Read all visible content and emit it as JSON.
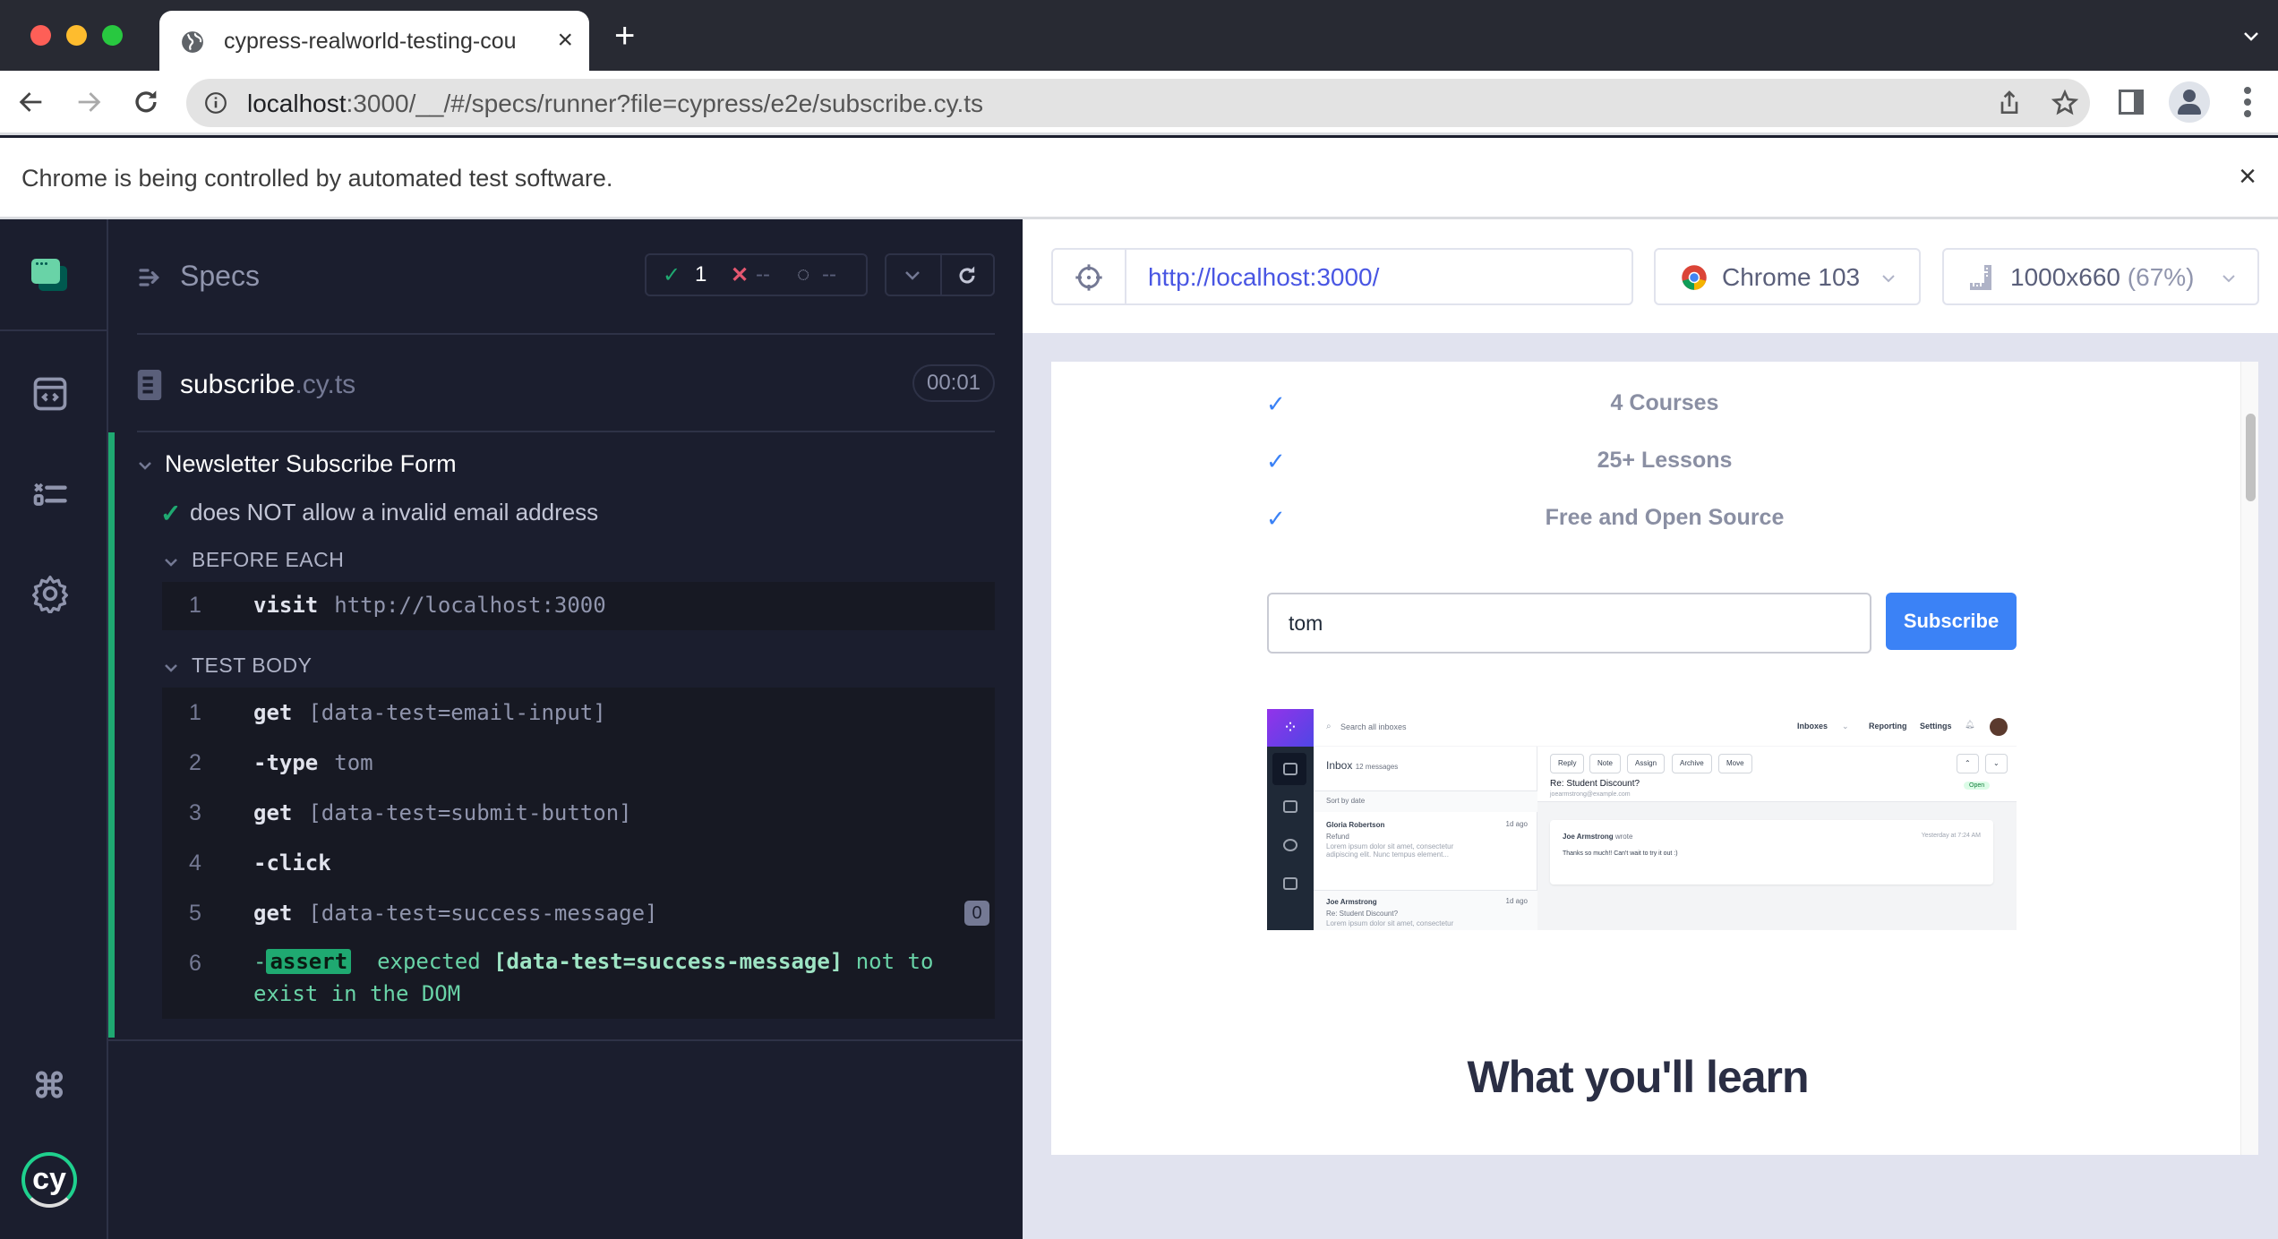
{
  "browser": {
    "tab_title": "cypress-realworld-testing-cou",
    "url_host": "localhost",
    "url_rest": ":3000/__/#/specs/runner?file=cypress/e2e/subscribe.cy.ts",
    "automation_banner": "Chrome is being controlled by automated test software.",
    "new_tab": "+",
    "close": "×"
  },
  "reporter": {
    "specs_label": "Specs",
    "stats": {
      "passed": "1",
      "failed": "--",
      "pending": "--"
    },
    "spec_file": {
      "name": "subscribe",
      "ext": ".cy.ts",
      "duration": "00:01"
    },
    "suite_title": "Newsletter Subscribe Form",
    "test_title": "does NOT allow a invalid email address",
    "hooks": [
      {
        "title": "BEFORE EACH",
        "commands": [
          {
            "num": "1",
            "name": "visit",
            "arg": "http://localhost:3000"
          }
        ]
      },
      {
        "title": "TEST BODY",
        "commands": [
          {
            "num": "1",
            "name": "get",
            "arg": "[data-test=email-input]"
          },
          {
            "num": "2",
            "name": "-type",
            "arg": "tom"
          },
          {
            "num": "3",
            "name": "get",
            "arg": "[data-test=submit-button]"
          },
          {
            "num": "4",
            "name": "-click",
            "arg": ""
          },
          {
            "num": "5",
            "name": "get",
            "arg": "[data-test=success-message]",
            "badge": "0"
          },
          {
            "num": "6",
            "name": "-",
            "assert_tag": "assert",
            "assert_pre": "expected",
            "assert_selector": "[data-test=success-message]",
            "assert_post": "not to exist in the DOM"
          }
        ]
      }
    ]
  },
  "aut": {
    "url": "http://localhost:3000/",
    "browser_label": "Chrome 103",
    "viewport": "1000x660",
    "viewport_scale": "(67%)",
    "features": [
      "4 Courses",
      "25+ Lessons",
      "Free and Open Source"
    ],
    "email_value": "tom",
    "subscribe_label": "Subscribe",
    "section_heading": "What you'll learn",
    "mock_inbox": {
      "search_placeholder": "Search all inboxes",
      "nav": [
        "Inboxes",
        "Reporting",
        "Settings"
      ],
      "inbox_label": "Inbox",
      "inbox_count": "12 messages",
      "sort_label": "Sort by date",
      "toolbar": [
        "Reply",
        "Note",
        "Assign",
        "Archive",
        "Move"
      ],
      "messages": [
        {
          "from": "Gloria Robertson",
          "time": "1d ago",
          "subject": "Refund",
          "preview": "Lorem ipsum dolor sit amet, consectetur adipiscing elit. Nunc tempus element..."
        },
        {
          "from": "Joe Armstrong",
          "time": "1d ago",
          "subject": "Re: Student Discount?",
          "preview": "Lorem ipsum dolor sit amet, consectetur"
        }
      ],
      "detail_subject": "Re: Student Discount?",
      "detail_email": "joearmstrong@example.com",
      "status": "Open",
      "reply_from": "Joe Armstrong",
      "reply_wrote": "wrote",
      "reply_time": "Yesterday at 7:24 AM",
      "reply_body": "Thanks so much!! Can't wait to try it out :)"
    }
  },
  "colors": {
    "pass": "#1fa971",
    "fail": "#e45770",
    "accent_blue": "#3b82f6",
    "url_blue": "#4956e3"
  }
}
